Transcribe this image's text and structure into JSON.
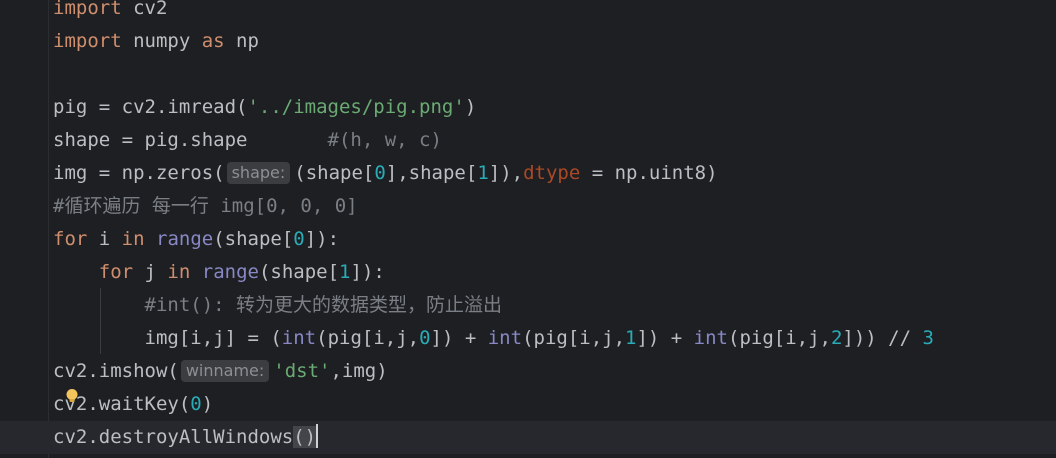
{
  "code": {
    "l1": {
      "kw": "import",
      "rest": " cv2"
    },
    "l2": {
      "kw1": "import",
      "mid": " numpy ",
      "kw2": "as",
      "rest": " np"
    },
    "l4": {
      "a": "pig = cv2.imread(",
      "str": "'../images/pig.png'",
      "b": ")"
    },
    "l5": {
      "a": "shape = pig.shape       ",
      "cm": "#(h, w, c)"
    },
    "l6": {
      "a": "img = np.zeros(",
      "hint": "shape:",
      "b": "(shape[",
      "n0": "0",
      "c": "],shape[",
      "n1": "1",
      "d": "]),",
      "param": "dtype",
      "e": " = np.uint8)"
    },
    "l7": {
      "cm": "#循环遍历 每一行 img[0, 0, 0]"
    },
    "l8": {
      "kw1": "for",
      "a": " i ",
      "kw2": "in",
      "sp": " ",
      "bi": "range",
      "b": "(shape[",
      "n": "0",
      "c": "]):"
    },
    "l9": {
      "indent": "    ",
      "kw1": "for",
      "a": " j ",
      "kw2": "in",
      "sp": " ",
      "bi": "range",
      "b": "(shape[",
      "n": "1",
      "c": "]):"
    },
    "l10": {
      "indent": "        ",
      "cm": "#int(): 转为更大的数据类型，防止溢出"
    },
    "l11": {
      "indent": "        ",
      "a": "img[i,j] = (",
      "bi1": "int",
      "b": "(pig[i,j,",
      "n1": "0",
      "c": "]) + ",
      "bi2": "int",
      "d": "(pig[i,j,",
      "n2": "1",
      "e": "]) + ",
      "bi3": "int",
      "f": "(pig[i,j,",
      "n3": "2",
      "g": "])) // ",
      "n4": "3"
    },
    "l12": {
      "a": "cv2.imshow(",
      "hint": "winname:",
      "str": "'dst'",
      "b": ",img)"
    },
    "l13": {
      "a": "cv2.waitKey(",
      "n": "0",
      "b": ")"
    },
    "l14": {
      "a": "cv2.destroyAllWindows",
      "p": "()"
    }
  },
  "icons": {
    "bulb": "lightbulb-icon"
  },
  "colors": {
    "background": "#1e1f22",
    "keyword": "#cf8e6d",
    "function": "#56a8f5",
    "builtin": "#8888c6",
    "string": "#6aab73",
    "number": "#2aacb8",
    "comment": "#7a7e85"
  }
}
